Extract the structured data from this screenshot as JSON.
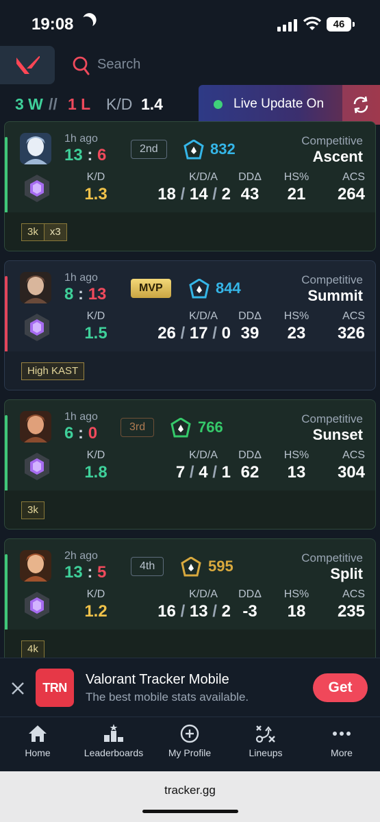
{
  "status_bar": {
    "time": "19:08",
    "battery": "46"
  },
  "header": {
    "search_placeholder": "Search"
  },
  "summary": {
    "wins": "3 W",
    "separator": "//",
    "losses": "1 L",
    "kd_label": "K/D",
    "kd_value": "1.4",
    "live_label": "Live Update On"
  },
  "matches": [
    {
      "result": "win",
      "ago": "1h ago",
      "score_us": "13",
      "score_them": "6",
      "placement": "2nd",
      "rr": "832",
      "rank_color": "#35b6e8",
      "mode": "Competitive",
      "map": "Ascent",
      "kd": "1.3",
      "kda_k": "18",
      "kda_d": "14",
      "kda_a": "2",
      "dd": "43",
      "hs": "21",
      "acs": "264",
      "tags": [
        "3k",
        "x3"
      ]
    },
    {
      "result": "loss",
      "ago": "1h ago",
      "score_us": "8",
      "score_them": "13",
      "placement": "MVP",
      "rr": "844",
      "rank_color": "#35b6e8",
      "mode": "Competitive",
      "map": "Summit",
      "kd": "1.5",
      "kda_k": "26",
      "kda_d": "17",
      "kda_a": "0",
      "dd": "39",
      "hs": "23",
      "acs": "326",
      "tags": [
        "High KAST"
      ]
    },
    {
      "result": "win",
      "ago": "1h ago",
      "score_us": "6",
      "score_them": "0",
      "placement": "3rd",
      "rr": "766",
      "rank_color": "#35c96a",
      "mode": "Competitive",
      "map": "Sunset",
      "kd": "1.8",
      "kda_k": "7",
      "kda_d": "4",
      "kda_a": "1",
      "dd": "62",
      "hs": "13",
      "acs": "304",
      "tags": [
        "3k"
      ]
    },
    {
      "result": "win",
      "ago": "2h ago",
      "score_us": "13",
      "score_them": "5",
      "placement": "4th",
      "rr": "595",
      "rank_color": "#d9a93e",
      "mode": "Competitive",
      "map": "Split",
      "kd": "1.2",
      "kda_k": "16",
      "kda_d": "13",
      "kda_a": "2",
      "dd": "-3",
      "hs": "18",
      "acs": "235",
      "tags": [
        "4k"
      ]
    }
  ],
  "stat_labels": {
    "kd": "K/D",
    "kda": "K/D/A",
    "dd": "DDΔ",
    "hs": "HS%",
    "acs": "ACS"
  },
  "ad": {
    "logo": "TRN",
    "title": "Valorant Tracker Mobile",
    "subtitle": "The best mobile stats available.",
    "cta": "Get"
  },
  "nav": [
    {
      "label": "Home",
      "icon": "home-icon"
    },
    {
      "label": "Leaderboards",
      "icon": "leaderboard-icon"
    },
    {
      "label": "My Profile",
      "icon": "plus-circle-icon"
    },
    {
      "label": "Lineups",
      "icon": "lineups-icon"
    },
    {
      "label": "More",
      "icon": "more-icon"
    }
  ],
  "browser": {
    "url": "tracker.gg"
  }
}
